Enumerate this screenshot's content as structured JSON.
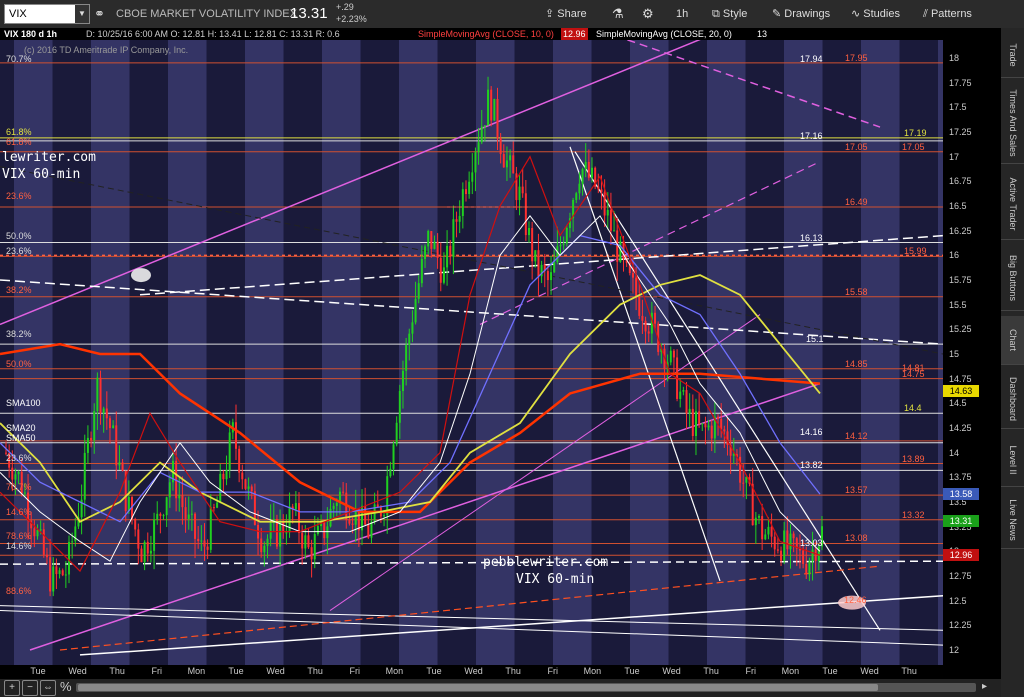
{
  "toolbar": {
    "symbol": "VIX",
    "description": "CBOE MARKET VOLATILITY INDEX",
    "last": "13.31",
    "change": "+.29",
    "change_pct": "+2.23%",
    "share": "Share",
    "interval": "1h",
    "style": "Style",
    "drawings": "Drawings",
    "studies": "Studies",
    "patterns": "Patterns"
  },
  "infobar": {
    "chart_title": "VIX 180 d 1h",
    "ohlc": "D: 10/25/16 6:00 AM   O: 12.81   H: 13.41   L: 12.81   C: 13.31   R: 0.6",
    "sma10_label": "SimpleMovingAvg (CLOSE, 10, 0)",
    "sma10_value": "12.96",
    "sma20_label": "SimpleMovingAvg (CLOSE, 20, 0)",
    "sma20_value": "13",
    "copyright": "(c) 2016 TD Ameritrade IP Company, Inc."
  },
  "watermark": {
    "site": "pebblewriter.com",
    "site_partial": "lewriter.com",
    "caption": "VIX 60-min"
  },
  "fib_labels": {
    "left": [
      "70.7%",
      "61.8%",
      "61.8%",
      "23.6%",
      "50.0%",
      "23.6%",
      "38.2%",
      "38.2%",
      "50.0%",
      "SMA100",
      "SMA20",
      "SMA50",
      "23.6%",
      "70.7%",
      "14.6%",
      "78.6%",
      "14.6%",
      "88.6%"
    ],
    "right_values": [
      "17.94",
      "17.16",
      "16.13",
      "15.1",
      "14.16",
      "13.82",
      "13.03"
    ],
    "right_red": [
      "17.95",
      "17.05",
      "17.05",
      "16.49",
      "15.99",
      "15.58",
      "14.85",
      "14.81",
      "14.75",
      "14.12",
      "13.89",
      "13.57",
      "13.32",
      "13.08",
      "12.46"
    ],
    "right_yellow": [
      "17.19",
      "14.4"
    ]
  },
  "yaxis": {
    "labels": [
      "18",
      "17.75",
      "17.5",
      "17.25",
      "17",
      "16.75",
      "16.5",
      "16.25",
      "16",
      "15.75",
      "15.5",
      "15.25",
      "15",
      "14.75",
      "14.5",
      "14.25",
      "14",
      "13.75",
      "13.5",
      "13.25",
      "13",
      "12.75",
      "12.5",
      "12.25",
      "12"
    ],
    "tags": [
      {
        "value": "14.63",
        "color": "#e8d800",
        "text_color": "#000"
      },
      {
        "value": "13.58",
        "color": "#3a5ab8",
        "text_color": "#fff"
      },
      {
        "value": "13.31",
        "color": "#1aa01a",
        "text_color": "#fff"
      },
      {
        "value": "12.96",
        "color": "#c01010",
        "text_color": "#fff"
      }
    ]
  },
  "xaxis": {
    "labels": [
      "Tue",
      "Wed",
      "Thu",
      "Fri",
      "Mon",
      "Tue",
      "Wed",
      "Thu",
      "Fri",
      "Mon",
      "Tue",
      "Wed",
      "Thu",
      "Fri",
      "Mon",
      "Tue",
      "Wed",
      "Thu",
      "Fri",
      "Mon",
      "Tue",
      "Wed",
      "Thu"
    ]
  },
  "sidebar": {
    "tabs": [
      "Trade",
      "Times And Sales",
      "Active Trader",
      "Big Buttons",
      "Chart",
      "Dashboard",
      "Level II",
      "Live News"
    ]
  },
  "bottom": {
    "zoom_label": "%"
  },
  "colors": {
    "chart_bg": "#1a1a3a",
    "band": "#4a4a88",
    "sma10": "#d01010",
    "sma20": "#ffffff",
    "sma50": "#7070ff",
    "sma100": "#e0e040",
    "sma200": "#ff3300",
    "channel": "#e060e0",
    "fib_red": "#d05030",
    "up_candle": "#20d020",
    "down_candle": "#ff3030"
  }
}
